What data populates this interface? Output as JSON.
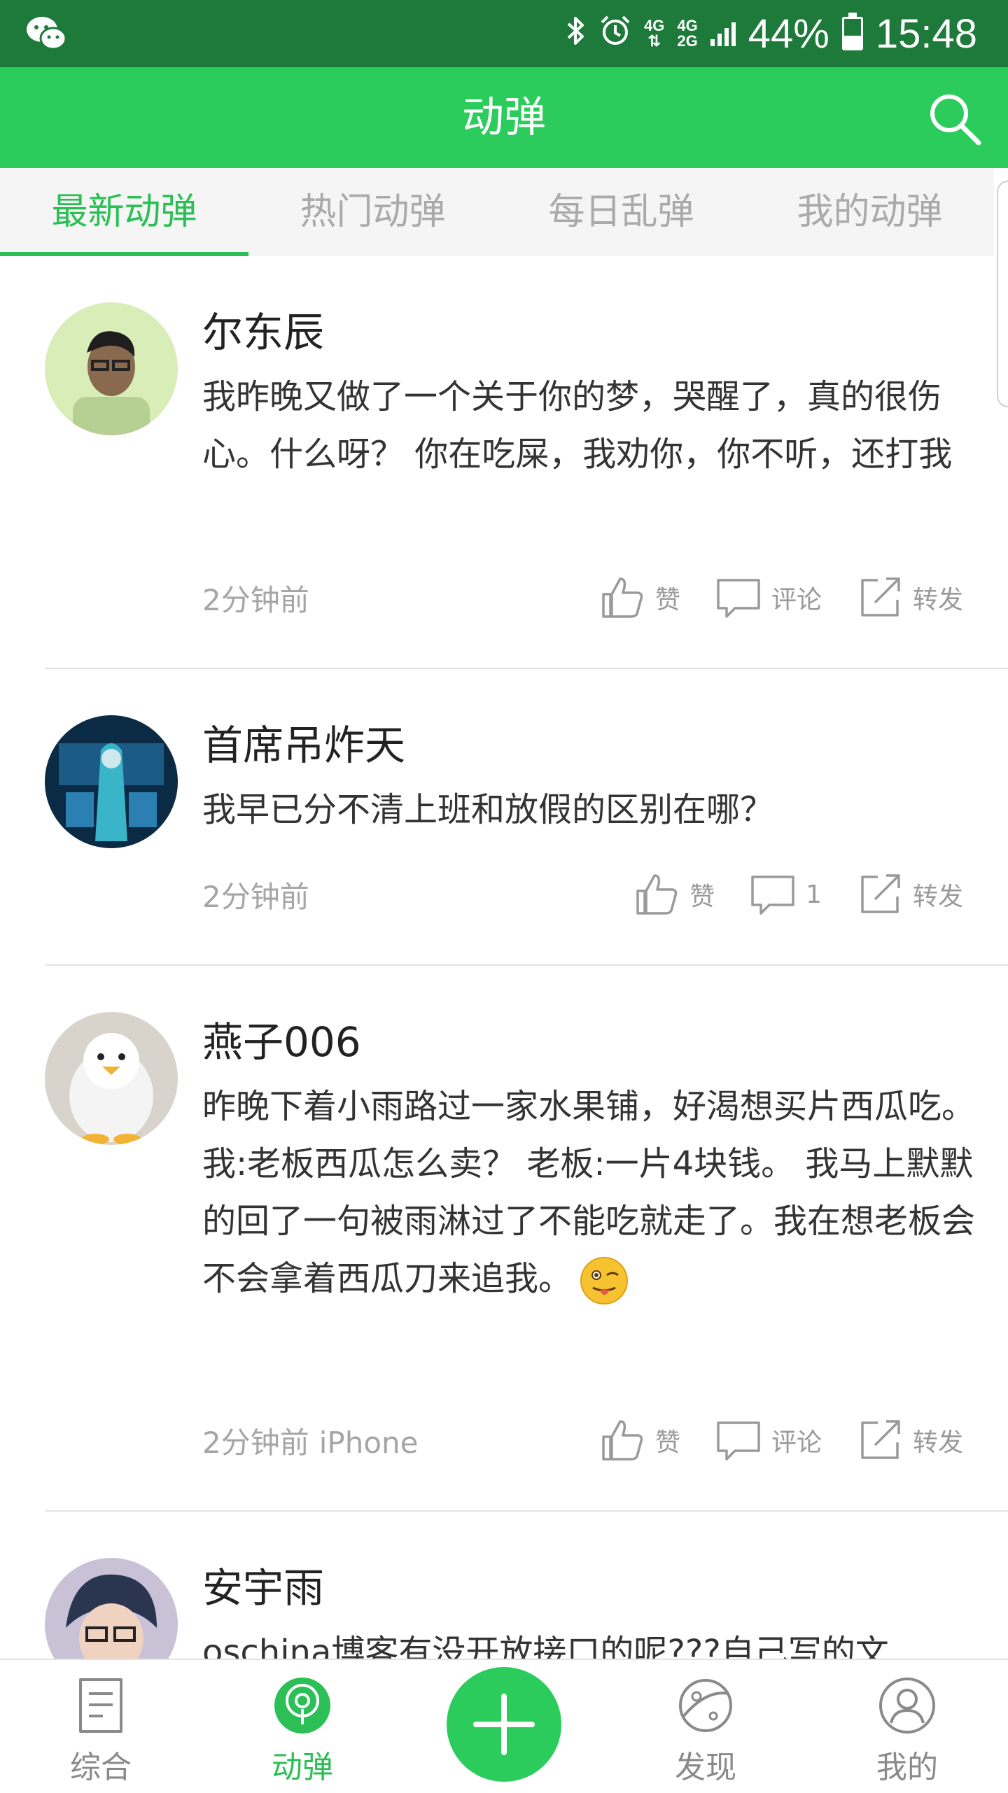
{
  "status_bar": {
    "network_top": "4G",
    "network_bottom": "4G",
    "network_sub": "2G",
    "battery_percent": "44%",
    "battery_level": 0.44,
    "time": "15:48"
  },
  "app_bar": {
    "title": "动弹"
  },
  "tabs": [
    {
      "label": "最新动弹",
      "active": true
    },
    {
      "label": "热门动弹",
      "active": false
    },
    {
      "label": "每日乱弹",
      "active": false
    },
    {
      "label": "我的动弹",
      "active": false
    }
  ],
  "posts": [
    {
      "username": "尔东辰",
      "content": "我昨晚又做了一个关于你的梦，哭醒了，真的很伤心。什么呀？ 你在吃屎，我劝你，你不听，还打我",
      "time": "2分钟前",
      "device": "",
      "like_label": "赞",
      "comment_label": "评论",
      "forward_label": "转发"
    },
    {
      "username": "首席吊炸天",
      "content": "我早已分不清上班和放假的区别在哪？",
      "time": "2分钟前",
      "device": "",
      "like_label": "赞",
      "comment_label": "1",
      "forward_label": "转发"
    },
    {
      "username": "燕子006",
      "content": "昨晚下着小雨路过一家水果铺，好渴想买片西瓜吃。 我:老板西瓜怎么卖？ 老板:一片4块钱。 我马上默默的回了一句被雨淋过了不能吃就走了。我在想老板会不会拿着西瓜刀来追我。",
      "time": "2分钟前",
      "device": "iPhone",
      "like_label": "赞",
      "comment_label": "评论",
      "forward_label": "转发"
    },
    {
      "username": "安宇雨",
      "content": "oschina博客有没开放接口的呢???自己写的文",
      "time": "",
      "device": "",
      "like_label": "",
      "comment_label": "",
      "forward_label": ""
    }
  ],
  "bottom_nav": [
    {
      "label": "综合",
      "icon": "document-icon",
      "active": false
    },
    {
      "label": "动弹",
      "icon": "tweet-icon",
      "active": true
    },
    {
      "label": "",
      "icon": "plus-icon",
      "active": false
    },
    {
      "label": "发现",
      "icon": "planet-icon",
      "active": false
    },
    {
      "label": "我的",
      "icon": "user-icon",
      "active": false
    }
  ],
  "colors": {
    "status_bar": "#1d7a3a",
    "primary": "#2bcc5b",
    "tab_active": "#2bbf55",
    "tab_inactive": "#aaaaaa",
    "meta_text": "#a5a5a5"
  }
}
